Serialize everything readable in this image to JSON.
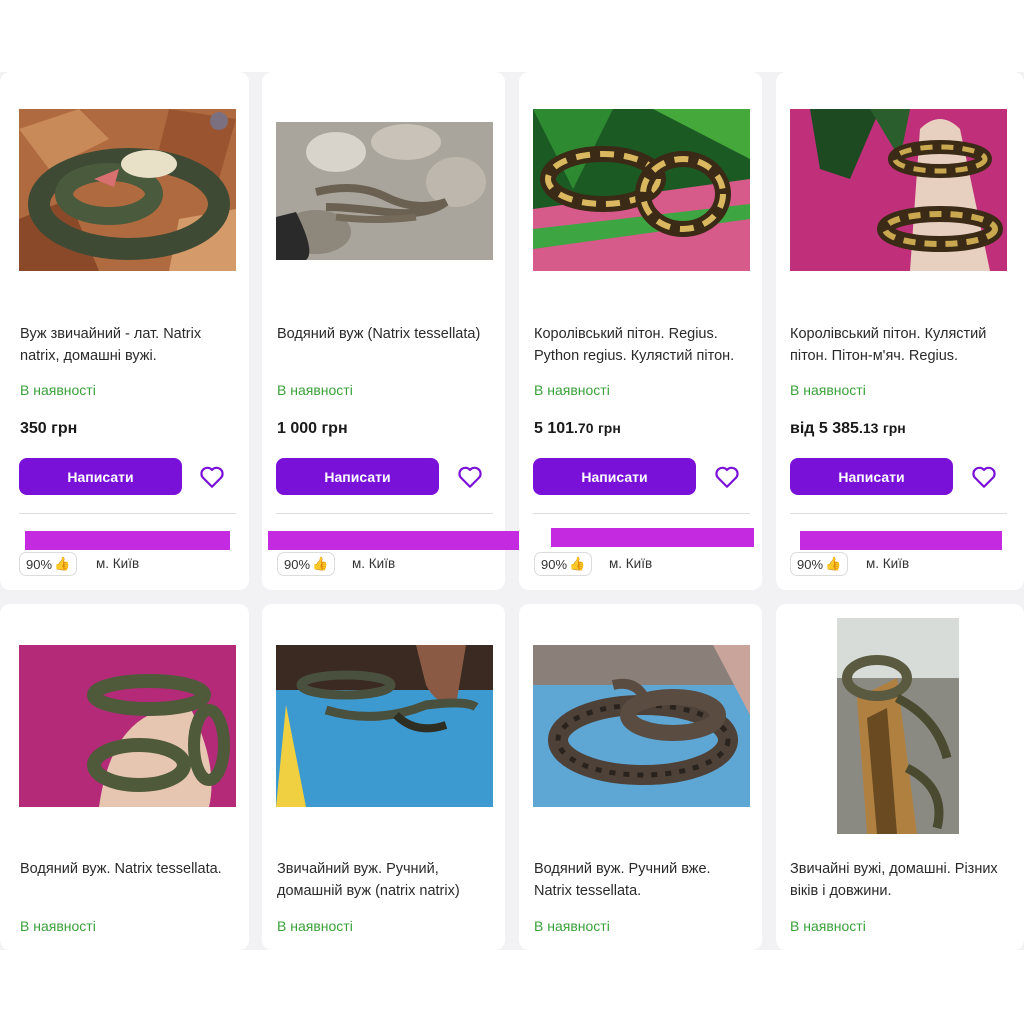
{
  "products": [
    {
      "title": "Вуж звичайний - лат. Natrix natrix, домашні вужі.",
      "status": "В наявності",
      "price_main": "350",
      "price_cents": "",
      "currency": "грн",
      "price_prefix": "",
      "button": "Написати",
      "rating": "90%",
      "city": "м. Київ",
      "icon": "heart-outline-icon",
      "image": "grass snake on brown leaves"
    },
    {
      "title": "Водяний вуж (Natrix tessellata)",
      "status": "В наявності",
      "price_main": "1 000",
      "price_cents": "",
      "currency": "грн",
      "price_prefix": "",
      "button": "Написати",
      "rating": "90%",
      "city": "м. Київ",
      "icon": "heart-outline-icon",
      "image": "dice snake on rocks"
    },
    {
      "title": "Королівський пітон. Regius. Python regius. Кулястий пітон.",
      "status": "В наявності",
      "price_main": "5 101",
      "price_cents": ".70",
      "currency": "грн",
      "price_prefix": "",
      "button": "Написати",
      "rating": "90%",
      "city": "м. Київ",
      "icon": "heart-outline-icon",
      "image": "ball python on green leaves"
    },
    {
      "title": "Королівський пітон. Кулястий пітон. Пітон-м'яч. Regius.",
      "status": "В наявності",
      "price_main": "5 385",
      "price_cents": ".13",
      "currency": "грн",
      "price_prefix": "від",
      "button": "Написати",
      "rating": "90%",
      "city": "м. Київ",
      "icon": "heart-outline-icon",
      "image": "ball python on hand, pink background"
    },
    {
      "title": "Водяний вуж. Natrix tessellata.",
      "status": "В наявності",
      "image": "snake held in hands, magenta background"
    },
    {
      "title": "Звичайний вуж. Ручний, домашній вуж (natrix natrix)",
      "status": "В наявності",
      "image": "snakes on blue cloth"
    },
    {
      "title": "Водяний вуж. Ручний вже. Natrix tessellata.",
      "status": "В наявності",
      "image": "dice snake on blue cloth"
    },
    {
      "title": "Звичайні вужі, домашні. Різних віків і довжини.",
      "status": "В наявності",
      "image": "snake in terrarium"
    }
  ],
  "colors": {
    "accent": "#7a11d8",
    "stock": "#3aa03a",
    "redaction": "#c42be0",
    "background": "#f2f2f4"
  }
}
